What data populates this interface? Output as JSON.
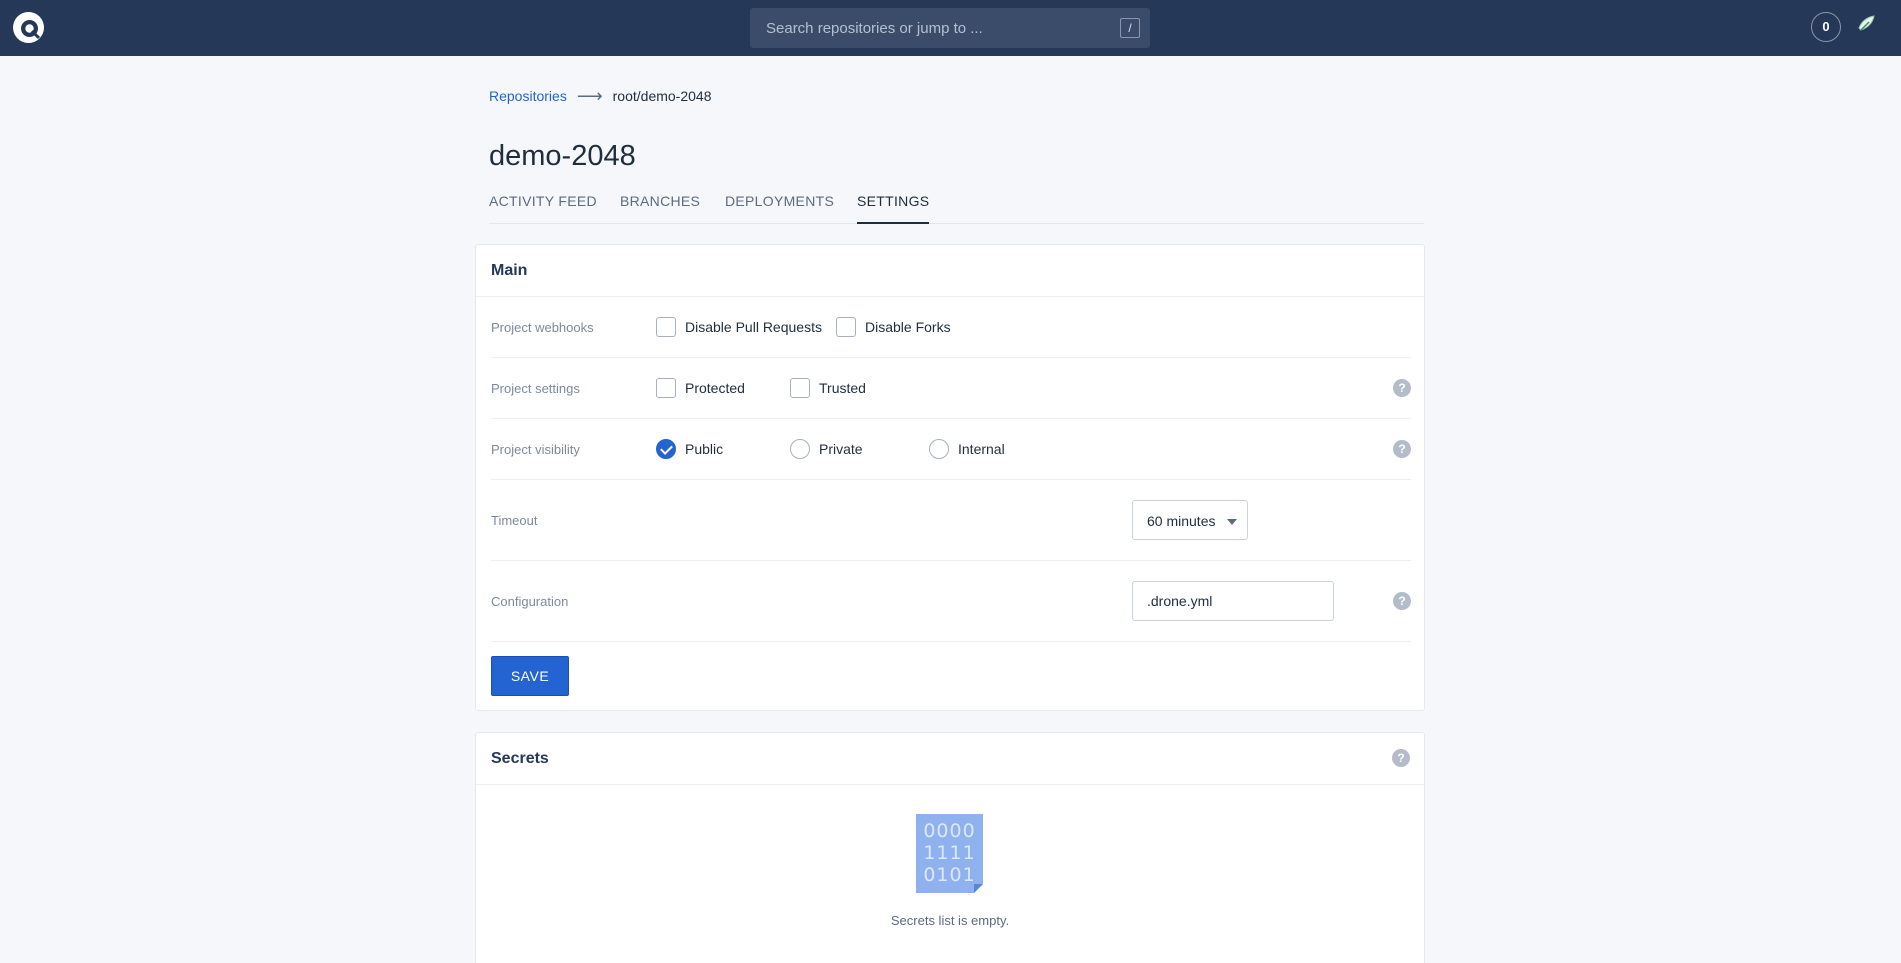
{
  "header": {
    "search_placeholder": "Search repositories or jump to ...",
    "search_shortcut": "/",
    "notification_count": "0"
  },
  "breadcrumb": {
    "parent": "Repositories",
    "current": "root/demo-2048"
  },
  "page": {
    "title": "demo-2048"
  },
  "tabs": [
    {
      "label": "ACTIVITY FEED",
      "active": false
    },
    {
      "label": "BRANCHES",
      "active": false
    },
    {
      "label": "DEPLOYMENTS",
      "active": false
    },
    {
      "label": "SETTINGS",
      "active": true
    }
  ],
  "main": {
    "title": "Main",
    "webhooks": {
      "label": "Project webhooks",
      "options": [
        {
          "label": "Disable Pull Requests",
          "checked": false
        },
        {
          "label": "Disable Forks",
          "checked": false
        }
      ]
    },
    "settings": {
      "label": "Project settings",
      "options": [
        {
          "label": "Protected",
          "checked": false
        },
        {
          "label": "Trusted",
          "checked": false
        }
      ]
    },
    "visibility": {
      "label": "Project visibility",
      "options": [
        {
          "label": "Public",
          "checked": true
        },
        {
          "label": "Private",
          "checked": false
        },
        {
          "label": "Internal",
          "checked": false
        }
      ]
    },
    "timeout": {
      "label": "Timeout",
      "value": "60 minutes"
    },
    "configuration": {
      "label": "Configuration",
      "value": ".drone.yml"
    },
    "save_label": "SAVE",
    "help_glyph": "?"
  },
  "secrets": {
    "title": "Secrets",
    "empty_text": "Secrets list is empty.",
    "icon_rows": [
      "0000",
      "1111",
      "0101"
    ]
  },
  "colors": {
    "header_bg": "#253858",
    "accent": "#2364d2",
    "page_bg": "#f5f7fa"
  }
}
